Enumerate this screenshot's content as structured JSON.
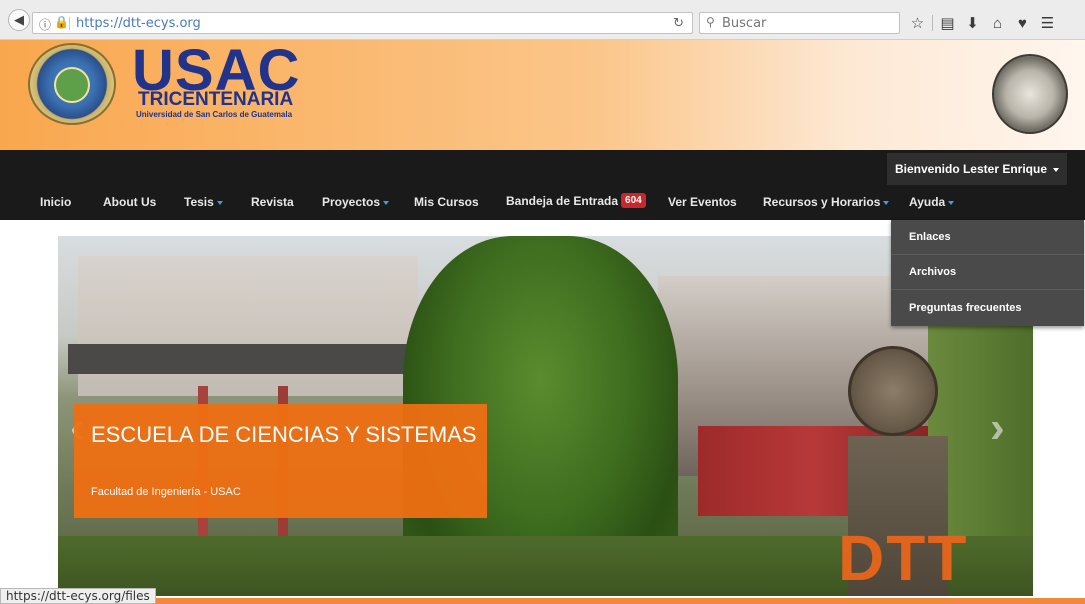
{
  "browser": {
    "url": "https://dtt-ecys.org",
    "search_placeholder": "Buscar",
    "status_url": "https://dtt-ecys.org/files"
  },
  "header": {
    "logo_main": "USAC",
    "logo_tricentenaria": "TRICENTENARIA",
    "logo_subtitle": "Universidad de San Carlos de Guatemala"
  },
  "nav": {
    "welcome": "Bienvenido Lester Enrique",
    "items": [
      {
        "label": "Inicio"
      },
      {
        "label": "About Us"
      },
      {
        "label": "Tesis"
      },
      {
        "label": "Revista"
      },
      {
        "label": "Proyectos"
      },
      {
        "label": "Mis Cursos"
      },
      {
        "label": "Bandeja de Entrada",
        "badge": "604"
      },
      {
        "label": "Ver Eventos"
      },
      {
        "label": "Recursos y Horarios"
      },
      {
        "label": "Ayuda"
      }
    ]
  },
  "dropdown": {
    "items": [
      "Enlaces",
      "Archivos",
      "Preguntas frecuentes"
    ]
  },
  "slider": {
    "title": "ESCUELA DE CIENCIAS Y SISTEMAS",
    "subtitle": "Facultad de Ingeniería - USAC",
    "watermark": "DTT"
  },
  "colors": {
    "nav_bg": "#1a1a1a",
    "accent_orange": "#ee6f12",
    "logo_blue": "#21338b",
    "badge_red": "#c8272b",
    "caret_blue": "#3aa0e0"
  }
}
